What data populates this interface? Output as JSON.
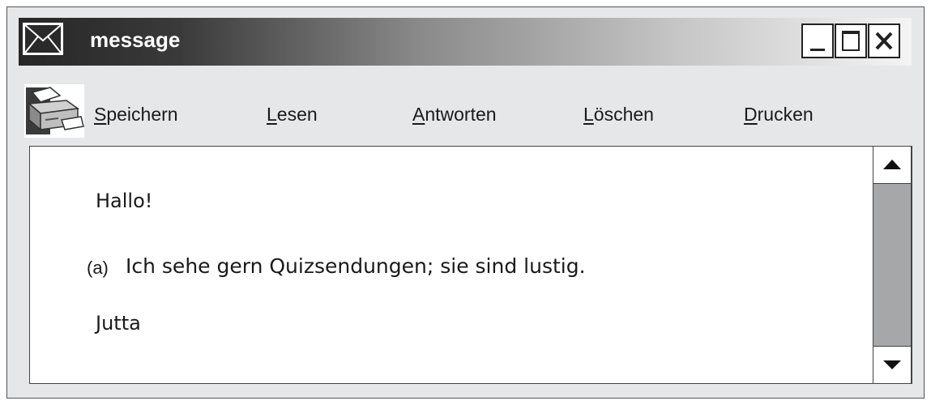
{
  "window": {
    "title": "message",
    "icon": "envelope-icon",
    "controls": [
      "minimize-icon",
      "maximize-icon",
      "close-icon"
    ]
  },
  "toolbar": {
    "icon": "printer-icon",
    "items": [
      {
        "access_key": "S",
        "rest": "peichern"
      },
      {
        "access_key": "L",
        "rest": "esen"
      },
      {
        "access_key": "A",
        "rest": "ntworten"
      },
      {
        "access_key": "L",
        "rest": "öschen"
      },
      {
        "access_key": "D",
        "rest": "rucken"
      }
    ]
  },
  "message": {
    "greeting": "Hallo!",
    "item_label": "(a)",
    "sentence": "Ich sehe gern Quizsendungen; sie sind lustig.",
    "signoff": "Jutta"
  },
  "colors": {
    "frame_background": "#e6e7e8",
    "titlebar_dark": "#262626",
    "titlebar_light": "#f4f4f4",
    "scrollbar_track": "#a6a7a9"
  }
}
